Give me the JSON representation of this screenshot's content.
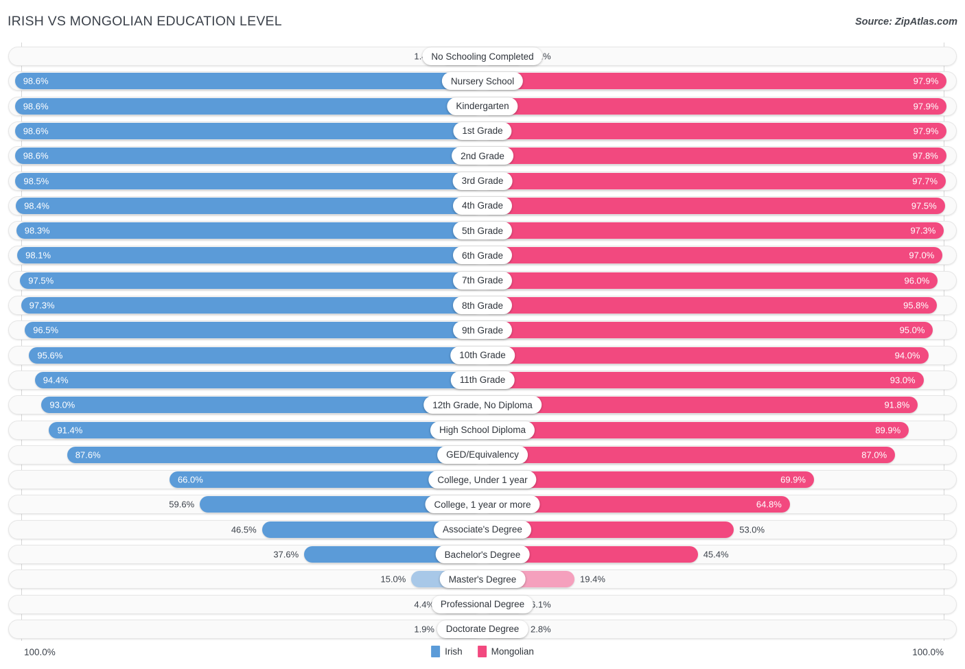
{
  "header": {
    "title": "IRISH VS MONGOLIAN EDUCATION LEVEL",
    "source": "Source: ZipAtlas.com"
  },
  "legend": {
    "items": [
      {
        "label": "Irish",
        "color": "#5b9bd8",
        "swatch": "legend-swatch-irish"
      },
      {
        "label": "Mongolian",
        "color": "#f2497f",
        "swatch": "legend-swatch-mongolian"
      }
    ]
  },
  "axis": {
    "left_end": "100.0%",
    "right_end": "100.0%"
  },
  "chart_data": {
    "type": "bar",
    "title": "IRISH VS MONGOLIAN EDUCATION LEVEL",
    "subtitle": "",
    "orientation": "horizontal-diverging",
    "xlabel": "",
    "ylabel": "",
    "xlim": [
      0,
      100
    ],
    "grid": true,
    "legend_position": "bottom-center",
    "categories": [
      "No Schooling Completed",
      "Nursery School",
      "Kindergarten",
      "1st Grade",
      "2nd Grade",
      "3rd Grade",
      "4th Grade",
      "5th Grade",
      "6th Grade",
      "7th Grade",
      "8th Grade",
      "9th Grade",
      "10th Grade",
      "11th Grade",
      "12th Grade, No Diploma",
      "High School Diploma",
      "GED/Equivalency",
      "College, Under 1 year",
      "College, 1 year or more",
      "Associate's Degree",
      "Bachelor's Degree",
      "Master's Degree",
      "Professional Degree",
      "Doctorate Degree"
    ],
    "series": [
      {
        "name": "Irish",
        "color": "#5b9bd8",
        "side": "left",
        "values": [
          1.4,
          98.6,
          98.6,
          98.6,
          98.6,
          98.5,
          98.4,
          98.3,
          98.1,
          97.5,
          97.3,
          96.5,
          95.6,
          94.4,
          93.0,
          91.4,
          87.6,
          66.0,
          59.6,
          46.5,
          37.6,
          15.0,
          4.4,
          1.9
        ]
      },
      {
        "name": "Mongolian",
        "color": "#f2497f",
        "side": "right",
        "values": [
          2.1,
          97.9,
          97.9,
          97.9,
          97.8,
          97.7,
          97.5,
          97.3,
          97.0,
          96.0,
          95.8,
          95.0,
          94.0,
          93.0,
          91.8,
          89.9,
          87.0,
          69.9,
          64.8,
          53.0,
          45.4,
          19.4,
          6.1,
          2.8
        ]
      }
    ]
  },
  "rows": [
    {
      "label": "No Schooling Completed",
      "left_value": "1.4%",
      "right_value": "2.1%",
      "left_num": 1.4,
      "right_num": 2.1,
      "faded": true
    },
    {
      "label": "Nursery School",
      "left_value": "98.6%",
      "right_value": "97.9%",
      "left_num": 98.6,
      "right_num": 97.9,
      "faded": false
    },
    {
      "label": "Kindergarten",
      "left_value": "98.6%",
      "right_value": "97.9%",
      "left_num": 98.6,
      "right_num": 97.9,
      "faded": false
    },
    {
      "label": "1st Grade",
      "left_value": "98.6%",
      "right_value": "97.9%",
      "left_num": 98.6,
      "right_num": 97.9,
      "faded": false
    },
    {
      "label": "2nd Grade",
      "left_value": "98.6%",
      "right_value": "97.8%",
      "left_num": 98.6,
      "right_num": 97.8,
      "faded": false
    },
    {
      "label": "3rd Grade",
      "left_value": "98.5%",
      "right_value": "97.7%",
      "left_num": 98.5,
      "right_num": 97.7,
      "faded": false
    },
    {
      "label": "4th Grade",
      "left_value": "98.4%",
      "right_value": "97.5%",
      "left_num": 98.4,
      "right_num": 97.5,
      "faded": false
    },
    {
      "label": "5th Grade",
      "left_value": "98.3%",
      "right_value": "97.3%",
      "left_num": 98.3,
      "right_num": 97.3,
      "faded": false
    },
    {
      "label": "6th Grade",
      "left_value": "98.1%",
      "right_value": "97.0%",
      "left_num": 98.1,
      "right_num": 97.0,
      "faded": false
    },
    {
      "label": "7th Grade",
      "left_value": "97.5%",
      "right_value": "96.0%",
      "left_num": 97.5,
      "right_num": 96.0,
      "faded": false
    },
    {
      "label": "8th Grade",
      "left_value": "97.3%",
      "right_value": "95.8%",
      "left_num": 97.3,
      "right_num": 95.8,
      "faded": false
    },
    {
      "label": "9th Grade",
      "left_value": "96.5%",
      "right_value": "95.0%",
      "left_num": 96.5,
      "right_num": 95.0,
      "faded": false
    },
    {
      "label": "10th Grade",
      "left_value": "95.6%",
      "right_value": "94.0%",
      "left_num": 95.6,
      "right_num": 94.0,
      "faded": false
    },
    {
      "label": "11th Grade",
      "left_value": "94.4%",
      "right_value": "93.0%",
      "left_num": 94.4,
      "right_num": 93.0,
      "faded": false
    },
    {
      "label": "12th Grade, No Diploma",
      "left_value": "93.0%",
      "right_value": "91.8%",
      "left_num": 93.0,
      "right_num": 91.8,
      "faded": false
    },
    {
      "label": "High School Diploma",
      "left_value": "91.4%",
      "right_value": "89.9%",
      "left_num": 91.4,
      "right_num": 89.9,
      "faded": false
    },
    {
      "label": "GED/Equivalency",
      "left_value": "87.6%",
      "right_value": "87.0%",
      "left_num": 87.6,
      "right_num": 87.0,
      "faded": false
    },
    {
      "label": "College, Under 1 year",
      "left_value": "66.0%",
      "right_value": "69.9%",
      "left_num": 66.0,
      "right_num": 69.9,
      "faded": false
    },
    {
      "label": "College, 1 year or more",
      "left_value": "59.6%",
      "right_value": "64.8%",
      "left_num": 59.6,
      "right_num": 64.8,
      "faded": false
    },
    {
      "label": "Associate's Degree",
      "left_value": "46.5%",
      "right_value": "53.0%",
      "left_num": 46.5,
      "right_num": 53.0,
      "faded": false
    },
    {
      "label": "Bachelor's Degree",
      "left_value": "37.6%",
      "right_value": "45.4%",
      "left_num": 37.6,
      "right_num": 45.4,
      "faded": false
    },
    {
      "label": "Master's Degree",
      "left_value": "15.0%",
      "right_value": "19.4%",
      "left_num": 15.0,
      "right_num": 19.4,
      "faded": true
    },
    {
      "label": "Professional Degree",
      "left_value": "4.4%",
      "right_value": "6.1%",
      "left_num": 4.4,
      "right_num": 6.1,
      "faded": true
    },
    {
      "label": "Doctorate Degree",
      "left_value": "1.9%",
      "right_value": "2.8%",
      "left_num": 1.9,
      "right_num": 2.8,
      "faded": true
    }
  ]
}
